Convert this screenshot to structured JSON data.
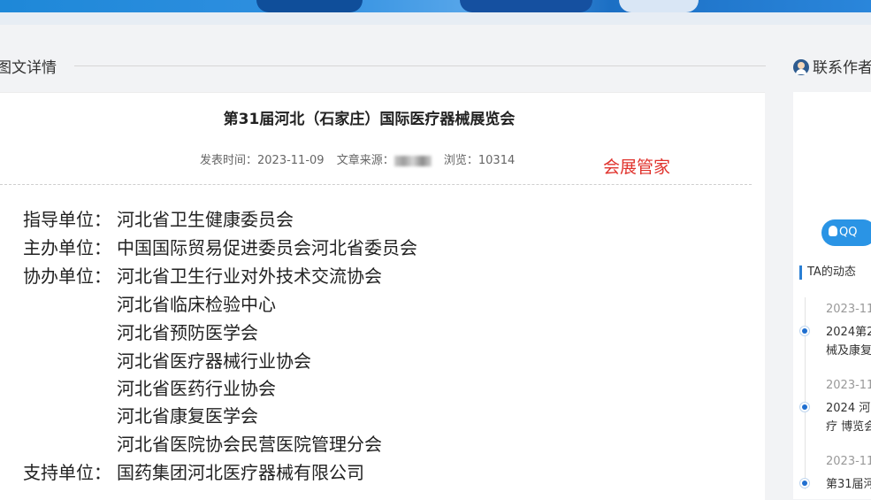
{
  "header": {
    "section_title": "图文详情",
    "contact_title": "联系作者"
  },
  "article": {
    "title": "第31届河北（石家庄）国际医疗器械展览会",
    "meta": {
      "publish_label": "发表时间：",
      "publish_date": "2023-11-09",
      "source_label": "文章来源：",
      "views_label": "浏览：",
      "views": "10314"
    },
    "watermark": "会展管家",
    "lines": [
      {
        "label": "指导单位：",
        "value": "河北省卫生健康委员会"
      },
      {
        "label": "主办单位：",
        "value": "中国国际贸易促进委员会河北省委员会"
      },
      {
        "label": "协办单位：",
        "value": "河北省卫生行业对外技术交流协会"
      },
      {
        "label": "",
        "value": "河北省临床检验中心"
      },
      {
        "label": "",
        "value": "河北省预防医学会"
      },
      {
        "label": "",
        "value": "河北省医疗器械行业协会"
      },
      {
        "label": "",
        "value": "河北省医药行业协会"
      },
      {
        "label": "",
        "value": "河北省康复医学会"
      },
      {
        "label": "",
        "value": "河北省医院协会民营医院管理分会"
      },
      {
        "label": "支持单位：",
        "value": "国药集团河北医疗器械有限公司"
      }
    ]
  },
  "sidebar": {
    "qq_label": "QQ",
    "activity_title": "TA的动态",
    "activities": [
      {
        "date": "2023-11",
        "line1": "2024第2",
        "line2": "械及康复"
      },
      {
        "date": "2023-11",
        "line1": "2024 河",
        "line2": "疗 博览会"
      },
      {
        "date": "2023-11",
        "line1": "第31届河",
        "line2": ""
      }
    ]
  },
  "colors": {
    "accent": "#2a94e5",
    "watermark": "#e0322c",
    "timeline_dot": "#1f6fd0"
  }
}
